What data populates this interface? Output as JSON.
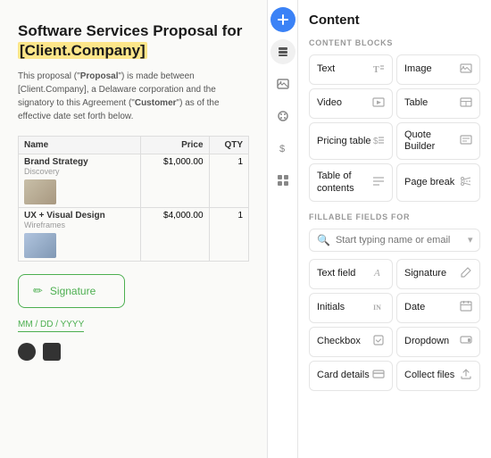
{
  "doc": {
    "title_part1": "Software Services Proposal for ",
    "title_highlight": "[Client.Company]",
    "subtitle": "This proposal (\"Proposal\") is made between [Client.Company], a Delaware corporation and the signatory to this Agreement (\"Customer\") as of the effective date set forth below.",
    "subtitle_bold": "Proposal",
    "table": {
      "headers": [
        "Name",
        "Price",
        "QTY"
      ],
      "rows": [
        {
          "name": "Brand Strategy",
          "sub": "Discovery",
          "price": "$1,000.00",
          "qty": "1"
        },
        {
          "name": "UX + Visual Design",
          "sub": "Wireframes",
          "price": "$4,000.00",
          "qty": "1"
        }
      ]
    },
    "signature_label": "Signature",
    "date_placeholder": "MM / DD / YYYY"
  },
  "sidebar": {
    "icons": [
      "plus",
      "layers",
      "image",
      "palette",
      "dollar",
      "grid"
    ]
  },
  "panel": {
    "title": "Content",
    "content_blocks_label": "CONTENT BLOCKS",
    "fillable_label": "FILLABLE FIELDS FOR",
    "search_placeholder": "Start typing name or email",
    "blocks": [
      {
        "name": "Text",
        "icon": "T"
      },
      {
        "name": "Image",
        "icon": "img"
      },
      {
        "name": "Video",
        "icon": "play"
      },
      {
        "name": "Table",
        "icon": "tbl"
      },
      {
        "name": "Pricing table",
        "icon": "price"
      },
      {
        "name": "Quote Builder",
        "icon": "quote"
      },
      {
        "name": "Table of contents",
        "icon": "list"
      },
      {
        "name": "Page break",
        "icon": "scissors"
      }
    ],
    "fields": [
      {
        "name": "Text field",
        "icon": "A"
      },
      {
        "name": "Signature",
        "icon": "pen"
      },
      {
        "name": "Initials",
        "icon": "IN"
      },
      {
        "name": "Date",
        "icon": "cal"
      },
      {
        "name": "Checkbox",
        "icon": "check"
      },
      {
        "name": "Dropdown",
        "icon": "arrow"
      },
      {
        "name": "Card details",
        "icon": "card"
      },
      {
        "name": "Collect files",
        "icon": "upload"
      }
    ]
  }
}
